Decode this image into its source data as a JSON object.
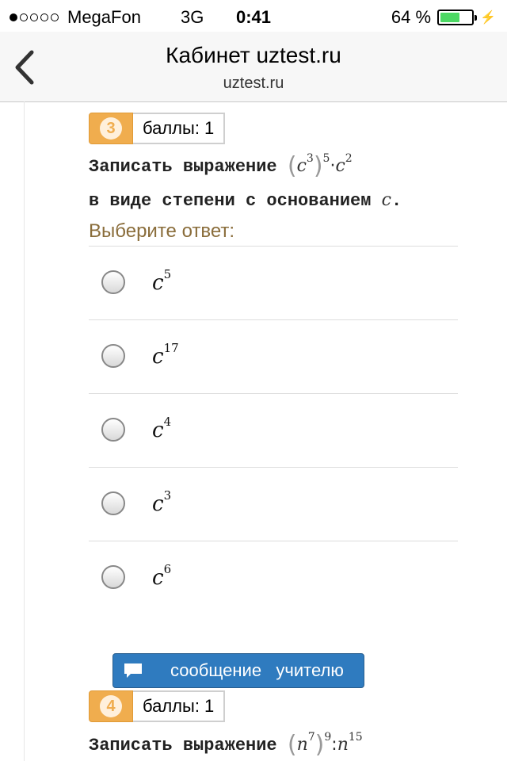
{
  "status_bar": {
    "carrier": "MegaFon",
    "network": "3G",
    "time": "0:41",
    "battery_percent": "64 %",
    "battery_level": 0.64,
    "signal_bars_filled": 1,
    "signal_bars_total": 5
  },
  "nav": {
    "title": "Кабинет uztest.ru",
    "subtitle": "uztest.ru",
    "back_icon": "chevron-left-icon"
  },
  "question3": {
    "number": "3",
    "points": "баллы: 1",
    "line1_text": "Записать выражение",
    "expr_base1": "c",
    "expr_exp_inner": "3",
    "expr_exp_outer": "5",
    "expr_op": "·",
    "expr_base2": "c",
    "expr_exp2": "2",
    "line2_text": "в виде степени с основанием",
    "line2_var": "c",
    "line2_end": "."
  },
  "choose_label": "Выберите ответ:",
  "answers": [
    {
      "base": "c",
      "exp": "5"
    },
    {
      "base": "c",
      "exp": "17"
    },
    {
      "base": "c",
      "exp": "4"
    },
    {
      "base": "c",
      "exp": "3"
    },
    {
      "base": "c",
      "exp": "6"
    }
  ],
  "message_button": {
    "label": "сообщение   учителю",
    "icon": "speech-bubble-icon"
  },
  "question4": {
    "number": "4",
    "points": "баллы: 1",
    "line1_text": "Записать выражение",
    "expr_base1": "n",
    "expr_exp_inner": "7",
    "expr_exp_outer": "9",
    "expr_op": ":",
    "expr_base2": "n",
    "expr_exp2": "15"
  },
  "colors": {
    "badge_orange": "#f0ad4e",
    "button_blue": "#2f7bbf",
    "label_brown": "#8a6d3b",
    "battery_green": "#4cd964"
  }
}
